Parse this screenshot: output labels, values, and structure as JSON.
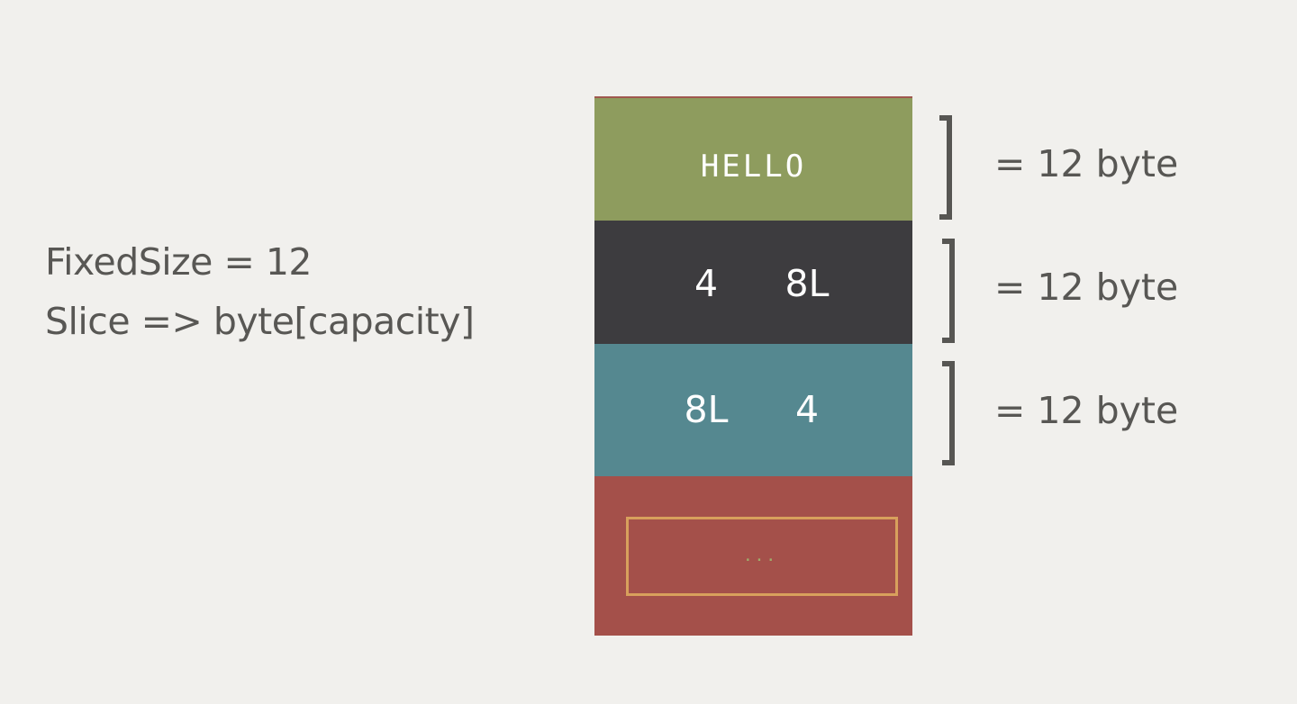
{
  "left_text": {
    "line1": "FixedSize = 12",
    "line2": "Slice => byte[capacity]"
  },
  "blocks": {
    "hello": {
      "label": "HELLO",
      "color": "#8e9c5e"
    },
    "dark": {
      "left": "4",
      "right": "8L",
      "color": "#3d3c3f"
    },
    "teal": {
      "left": "8L",
      "right": "4",
      "color": "#558890"
    },
    "red": {
      "ellipsis": "...",
      "color": "#a4504a",
      "box_color": "#d8a05c"
    }
  },
  "size_labels": [
    "= 12 byte",
    "= 12 byte",
    "= 12 byte"
  ],
  "colors": {
    "background": "#f1f0ed",
    "text": "#585754",
    "bracket": "#575653"
  }
}
